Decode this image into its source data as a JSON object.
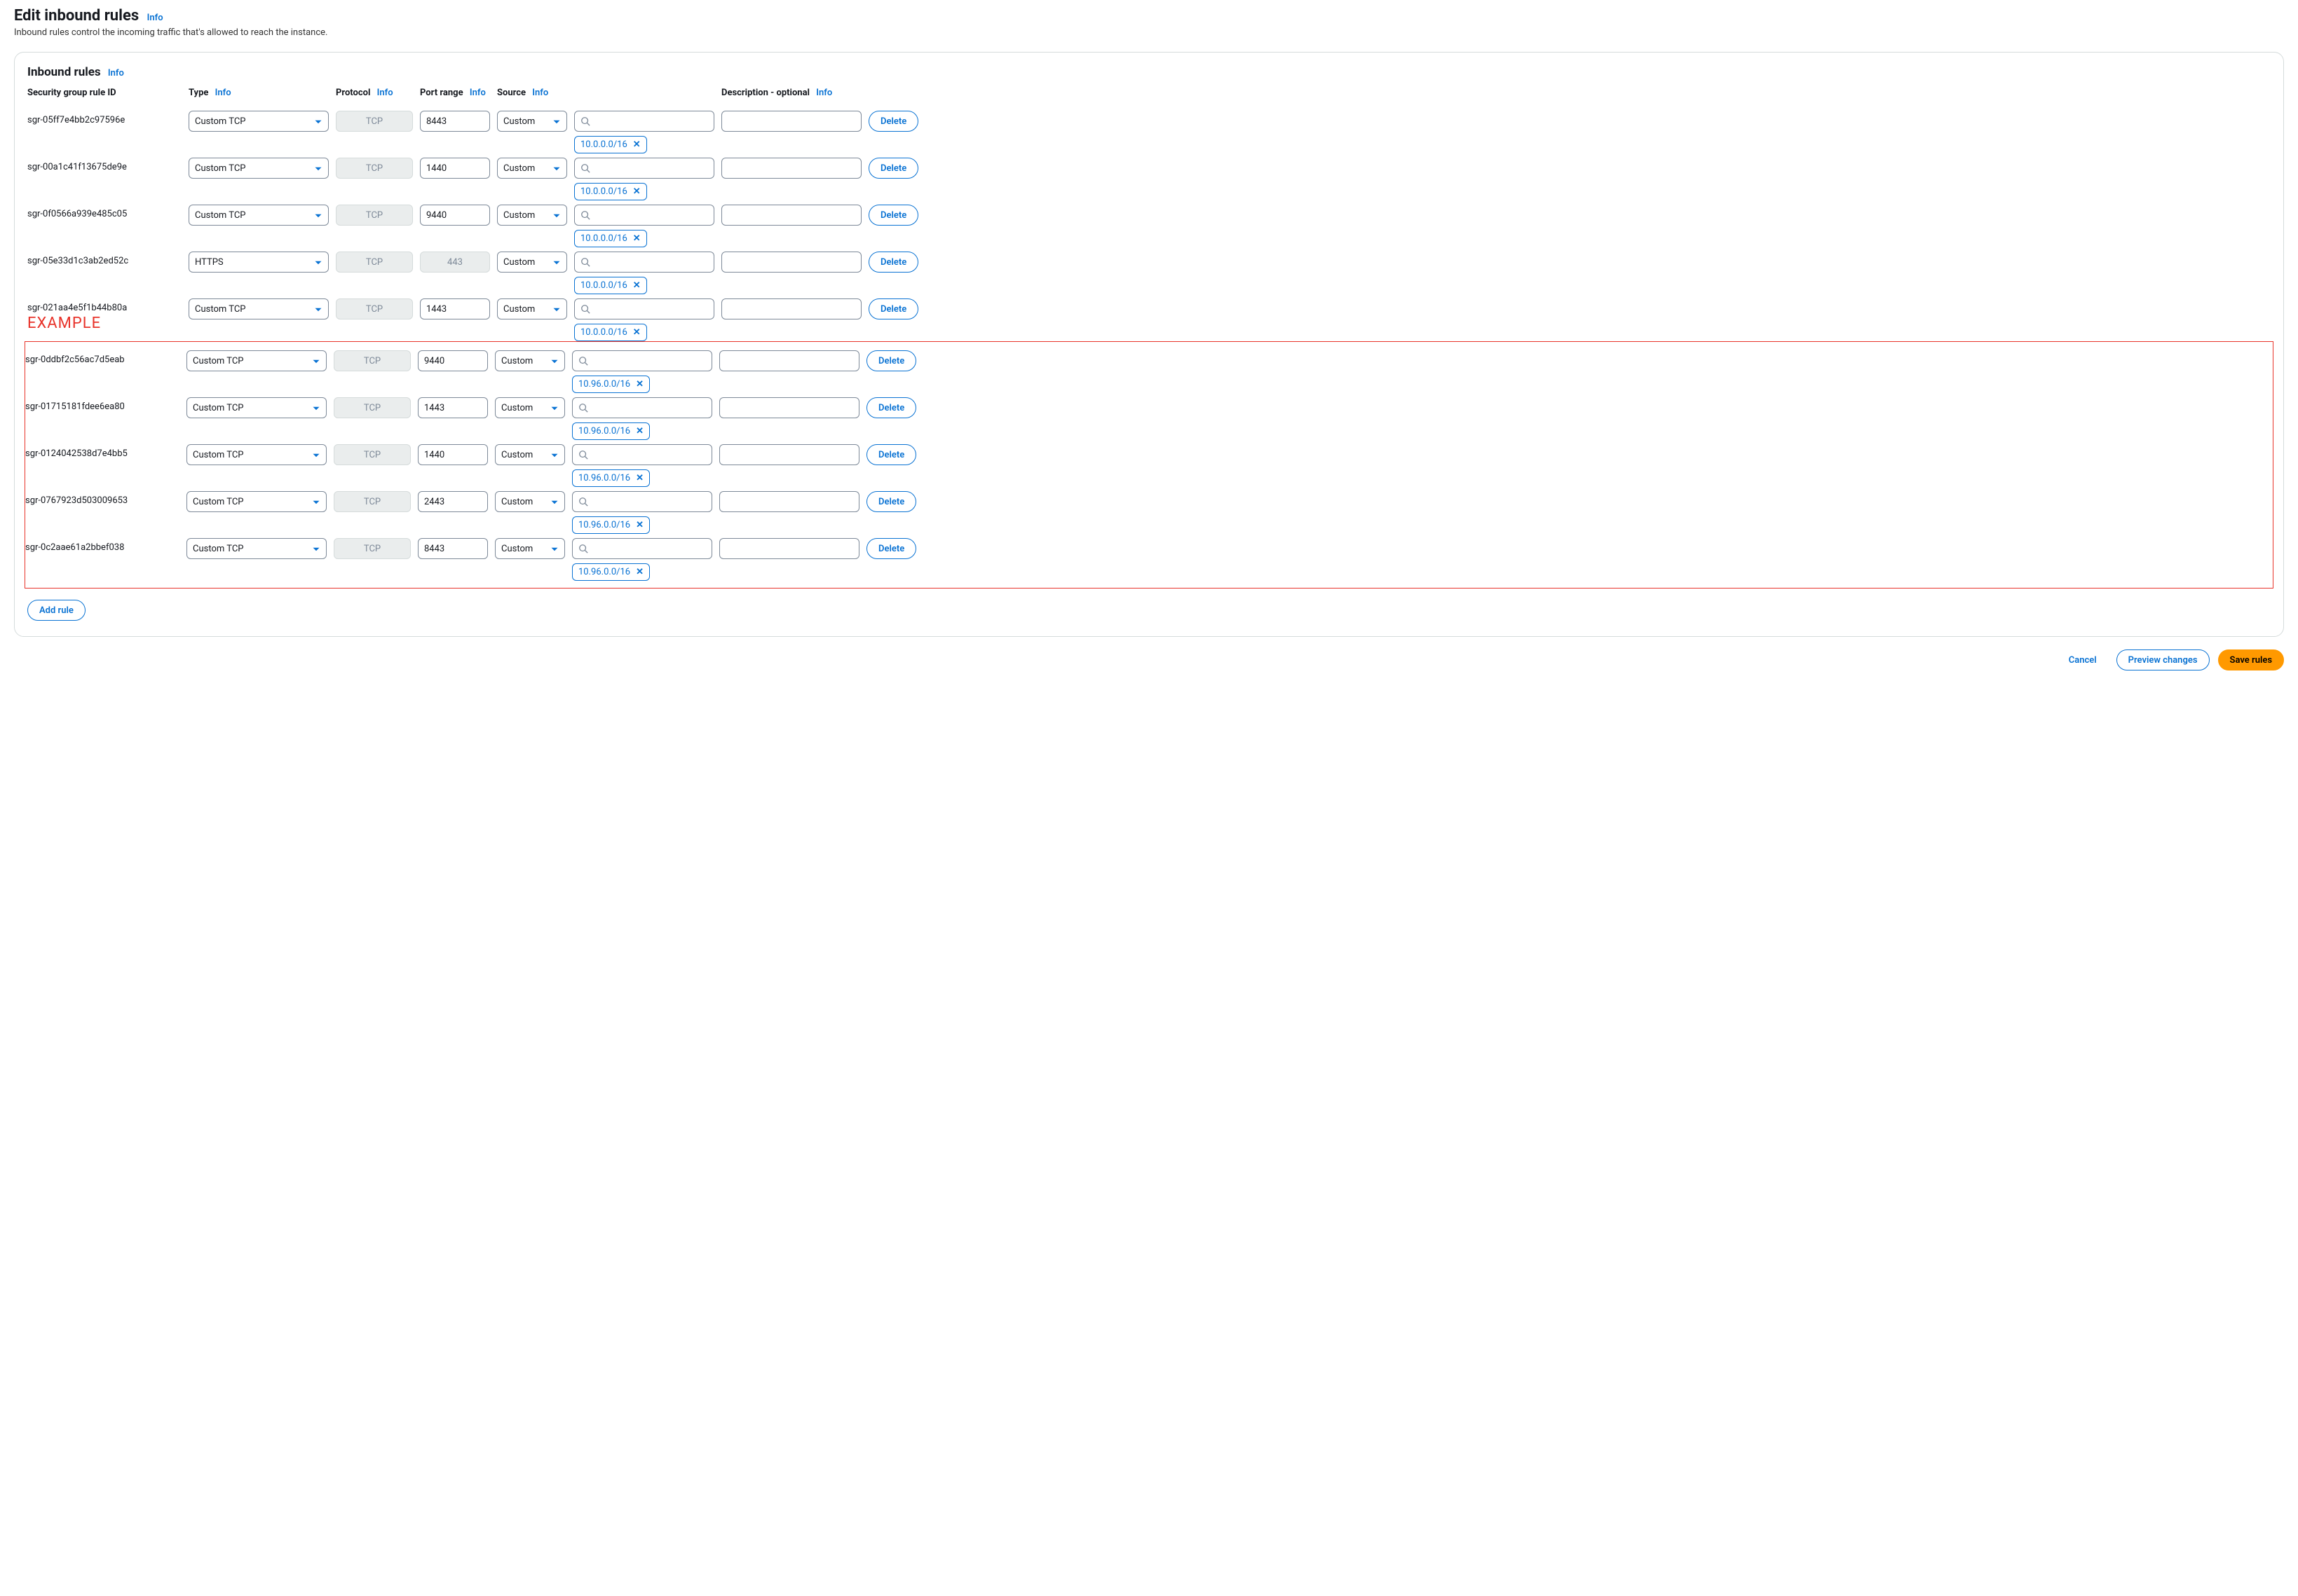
{
  "page": {
    "title": "Edit inbound rules",
    "subtitle": "Inbound rules control the incoming traffic that's allowed to reach the instance.",
    "info": "Info"
  },
  "panel": {
    "title": "Inbound rules",
    "info": "Info"
  },
  "headers": {
    "sgid": "Security group rule ID",
    "type": "Type",
    "protocol": "Protocol",
    "port": "Port range",
    "source": "Source",
    "description": "Description - optional",
    "info": "Info"
  },
  "example_label": "EXAMPLE",
  "rules": [
    {
      "sgid": "sgr-05ff7e4bb2c97596e",
      "type": "Custom TCP",
      "protocol": "TCP",
      "port": "8443",
      "port_disabled": false,
      "source": "Custom",
      "cidr": "10.0.0.0/16",
      "desc": ""
    },
    {
      "sgid": "sgr-00a1c41f13675de9e",
      "type": "Custom TCP",
      "protocol": "TCP",
      "port": "1440",
      "port_disabled": false,
      "source": "Custom",
      "cidr": "10.0.0.0/16",
      "desc": ""
    },
    {
      "sgid": "sgr-0f0566a939e485c05",
      "type": "Custom TCP",
      "protocol": "TCP",
      "port": "9440",
      "port_disabled": false,
      "source": "Custom",
      "cidr": "10.0.0.0/16",
      "desc": ""
    },
    {
      "sgid": "sgr-05e33d1c3ab2ed52c",
      "type": "HTTPS",
      "protocol": "TCP",
      "port": "443",
      "port_disabled": true,
      "source": "Custom",
      "cidr": "10.0.0.0/16",
      "desc": ""
    },
    {
      "sgid": "sgr-021aa4e5f1b44b80a",
      "type": "Custom TCP",
      "protocol": "TCP",
      "port": "1443",
      "port_disabled": false,
      "source": "Custom",
      "cidr": "10.0.0.0/16",
      "desc": "",
      "example": true
    },
    {
      "sgid": "sgr-0ddbf2c56ac7d5eab",
      "type": "Custom TCP",
      "protocol": "TCP",
      "port": "9440",
      "port_disabled": false,
      "source": "Custom",
      "cidr": "10.96.0.0/16",
      "desc": "",
      "hl": true
    },
    {
      "sgid": "sgr-01715181fdee6ea80",
      "type": "Custom TCP",
      "protocol": "TCP",
      "port": "1443",
      "port_disabled": false,
      "source": "Custom",
      "cidr": "10.96.0.0/16",
      "desc": "",
      "hl": true
    },
    {
      "sgid": "sgr-0124042538d7e4bb5",
      "type": "Custom TCP",
      "protocol": "TCP",
      "port": "1440",
      "port_disabled": false,
      "source": "Custom",
      "cidr": "10.96.0.0/16",
      "desc": "",
      "hl": true
    },
    {
      "sgid": "sgr-0767923d503009653",
      "type": "Custom TCP",
      "protocol": "TCP",
      "port": "2443",
      "port_disabled": false,
      "source": "Custom",
      "cidr": "10.96.0.0/16",
      "desc": "",
      "hl": true
    },
    {
      "sgid": "sgr-0c2aae61a2bbef038",
      "type": "Custom TCP",
      "protocol": "TCP",
      "port": "8443",
      "port_disabled": false,
      "source": "Custom",
      "cidr": "10.96.0.0/16",
      "desc": "",
      "hl": true
    }
  ],
  "buttons": {
    "delete": "Delete",
    "add_rule": "Add rule",
    "cancel": "Cancel",
    "preview": "Preview changes",
    "save": "Save rules"
  }
}
